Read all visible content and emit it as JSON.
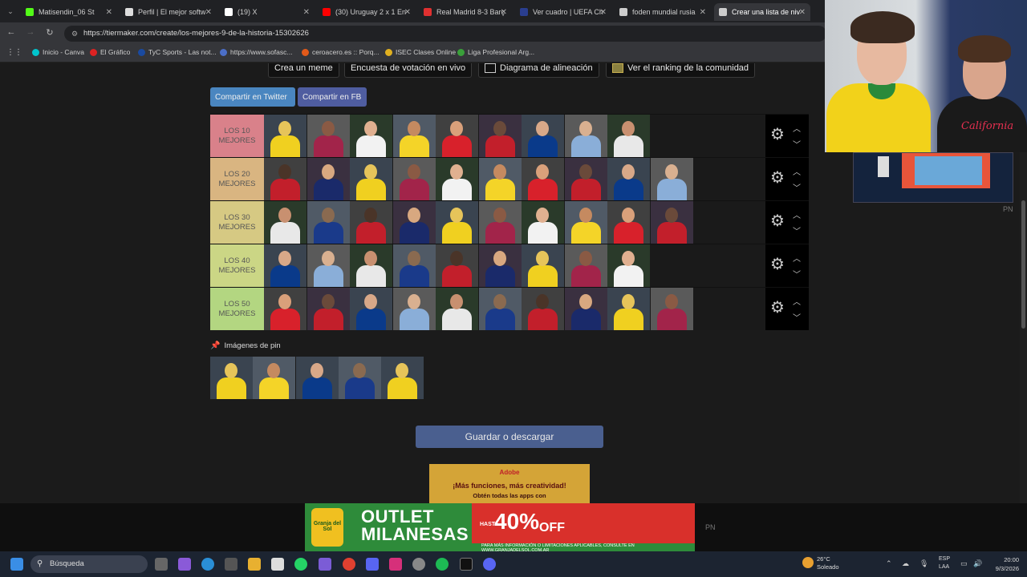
{
  "browser": {
    "tabs": [
      {
        "label": "Matisendin_06 St",
        "color": "#53fc18",
        "active": false
      },
      {
        "label": "Perfil | El mejor softw",
        "color": "#dddddd",
        "active": false
      },
      {
        "label": "(19) X",
        "color": "#ffffff",
        "active": false
      },
      {
        "label": "(30) Uruguay 2 x 1 En",
        "color": "#ff0000",
        "active": false
      },
      {
        "label": "Real Madrid 8-3 Barç",
        "color": "#e03030",
        "active": false
      },
      {
        "label": "Ver cuadro | UEFA Ch",
        "color": "#2a3e8f",
        "active": false
      },
      {
        "label": "foden mundial rusia",
        "color": "#cccccc",
        "active": false
      },
      {
        "label": "Crear una lista de niv",
        "color": "#cccccc",
        "active": true
      }
    ],
    "url": "https://tiermaker.com/create/los-mejores-9-de-la-historia-15302626",
    "bookmarks": [
      {
        "label": "Inicio - Canva",
        "color": "#00c4cc"
      },
      {
        "label": "El Gráfico",
        "color": "#d22"
      },
      {
        "label": "TyC Sports - Las not...",
        "color": "#1a4aa0"
      },
      {
        "label": "https://www.sofasc...",
        "color": "#4b6ec7"
      },
      {
        "label": "ceroacero.es :: Porq...",
        "color": "#e25a1a"
      },
      {
        "label": "ISEC Clases Online",
        "color": "#e0b020"
      },
      {
        "label": "Liga Profesional Arg...",
        "color": "#3aa03a"
      }
    ]
  },
  "toolbar_buttons": [
    "Crea un meme",
    "Encuesta de votación en vivo",
    "Diagrama de alineación",
    "Ver el ranking de la comunidad"
  ],
  "share": {
    "twitter": "Compartir en Twitter",
    "fb": "Compartir en FB"
  },
  "tiers": [
    {
      "line1": "LOS 10",
      "line2": "MEJORES",
      "color": "#d9818a",
      "players": 9
    },
    {
      "line1": "LOS 20",
      "line2": "MEJORES",
      "color": "#d9b581",
      "players": 10
    },
    {
      "line1": "LOS 30",
      "line2": "MEJORES",
      "color": "#d6c983",
      "players": 10
    },
    {
      "line1": "LOS 40",
      "line2": "MEJORES",
      "color": "#cbd685",
      "players": 9
    },
    {
      "line1": "LOS 50",
      "line2": "MEJORES",
      "color": "#b3d681",
      "players": 10
    }
  ],
  "pinned": {
    "label": "Imágenes de pin",
    "count": 5
  },
  "save_button": "Guardar o descargar",
  "ad_top": {
    "brand": "Adobe",
    "line1": "¡Más funciones, más creatividad!",
    "line2": "Obtén todas las apps con"
  },
  "ad_bottom": {
    "logo": "Granja del Sol",
    "headline1": "OUTLET",
    "headline2": "MILANESAS",
    "hasta": "HASTA",
    "percent": "40%",
    "off": "OFF",
    "fine": "PARA MÁS INFORMACIÓN O LIMITACIONES APLICABLES, CONSULTE EN WWW.GRANJADELSOL.COM.AR"
  },
  "pn_labels": [
    "PN",
    "PN"
  ],
  "taskbar": {
    "search": "Búsqueda",
    "temp": "26°C",
    "weather": "Soleado",
    "lang1": "ESP",
    "lang2": "LAA",
    "time": "20:00",
    "date": "9/3/2026"
  },
  "webcam_text": "California"
}
